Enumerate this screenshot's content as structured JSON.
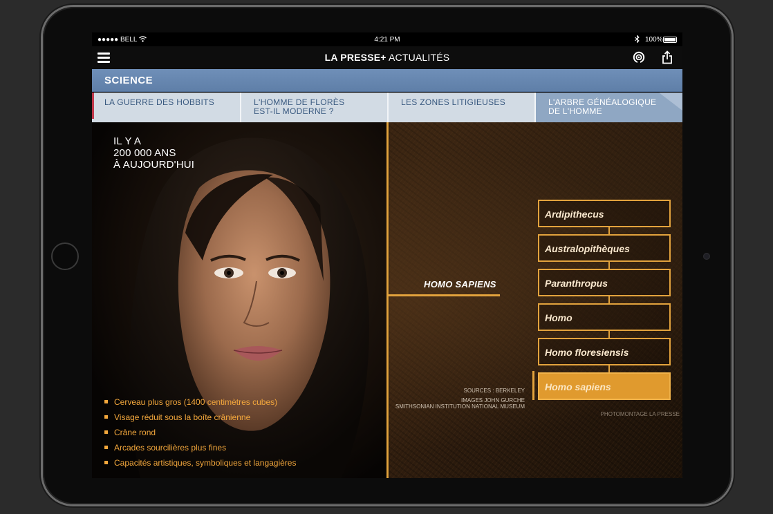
{
  "statusbar": {
    "carrier": "●●●●● BELL",
    "time": "4:21 PM",
    "battery": "100%"
  },
  "appbar": {
    "brand_bold": "LA PRESSE+",
    "brand_light": " ACTUALITÉS",
    "icons": [
      "menu-icon",
      "podcast-icon",
      "share-icon"
    ]
  },
  "section": {
    "title": "SCIENCE"
  },
  "tabs": [
    {
      "line1": "LA GUERRE DES HOBBITS",
      "line2": ""
    },
    {
      "line1": "L'HOMME DE FLORÈS",
      "line2": "EST-IL MODERNE ?"
    },
    {
      "line1": "LES ZONES LITIGIEUSES",
      "line2": ""
    },
    {
      "line1": "L'ARBRE GÉNÉALOGIQUE",
      "line2": "DE L'HOMME"
    }
  ],
  "active_tab": 3,
  "headline": {
    "line1": "IL Y A",
    "line2": "200 000 ANS",
    "line3": "À AUJOURD'HUI"
  },
  "features": [
    "Cerveau plus gros (1400 centimètres cubes)",
    "Visage réduit sous la boîte crânienne",
    "Crâne rond",
    "Arcades sourcilières plus fines",
    "Capacités artistiques, symboliques et langagières"
  ],
  "branch_label": "HOMO SAPIENS",
  "genera": [
    "Ardipithecus",
    "Australopithèques",
    "Paranthropus",
    "Homo",
    "Homo floresiensis",
    "Homo sapiens"
  ],
  "active_genus": "Homo sapiens",
  "sources": {
    "line1": "SOURCES : BERKELEY",
    "line2": "IMAGES JOHN GURCHE",
    "line3": "SMITHSONIAN INSTITUTION NATIONAL MUSEUM"
  },
  "credit": "PHOTOMONTAGE LA PRESSE",
  "colors": {
    "accent": "#e3a33d",
    "section_bar": "#6f8fb8",
    "tab_bg": "#d2dbe4",
    "tab_active_bg": "#8fa7c3",
    "tab_text": "#3a5a80"
  }
}
